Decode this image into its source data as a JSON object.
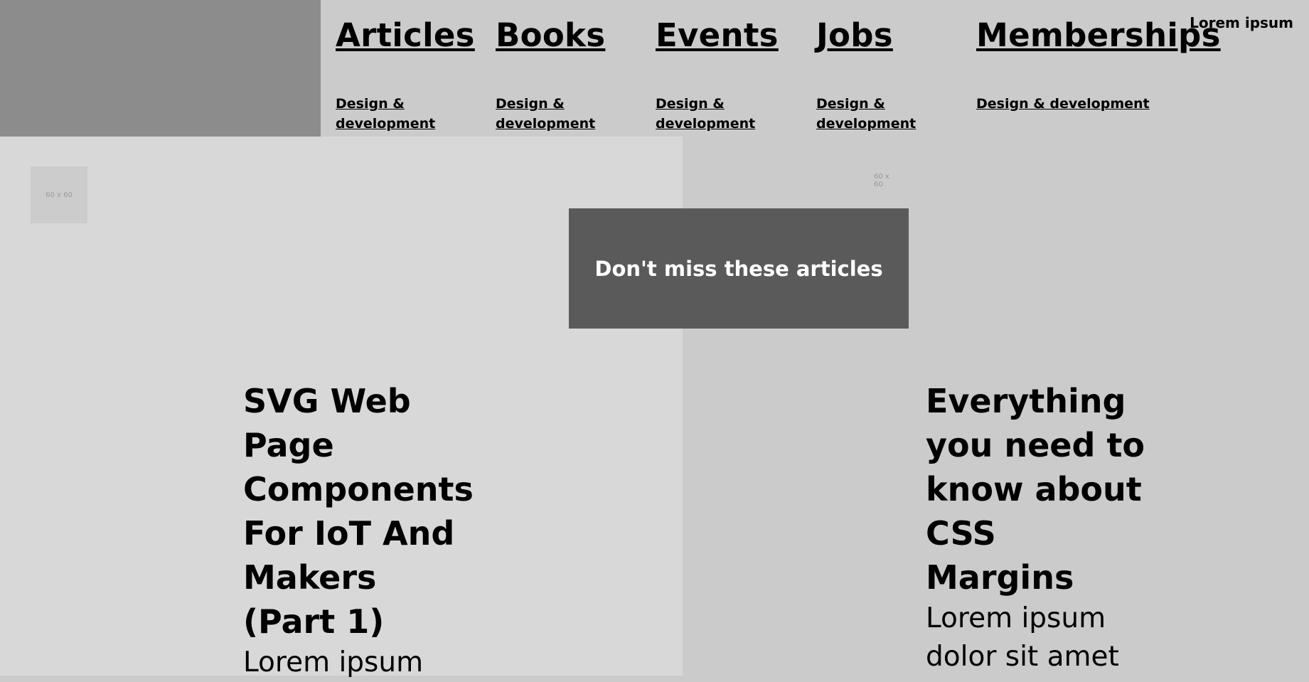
{
  "nav": {
    "items": [
      {
        "label": "Articles",
        "sub": "Design & development"
      },
      {
        "label": "Books",
        "sub": "Design & development"
      },
      {
        "label": "Events",
        "sub": "Design & development"
      },
      {
        "label": "Jobs",
        "sub": "Design & development"
      },
      {
        "label": "Memberships",
        "sub": "Design & development"
      }
    ],
    "extra": "Lorem ipsum"
  },
  "placeholders": {
    "left_thumb": "60 x 60",
    "right_thumb": "60 x 60"
  },
  "banner": {
    "text": "Don't miss these articles"
  },
  "articles": [
    {
      "title": "SVG Web Page Components For IoT And Makers (Part 1)",
      "body": "Lorem ipsum"
    },
    {
      "title": "Everything you need to know about CSS Margins",
      "body": "Lorem ipsum dolor sit amet"
    }
  ]
}
